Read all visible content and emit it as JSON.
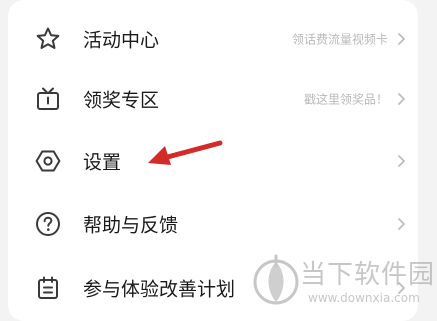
{
  "menu": {
    "items": [
      {
        "label": "活动中心",
        "hint": "领话费流量视频卡",
        "icon": "star-icon"
      },
      {
        "label": "领奖专区",
        "hint": "戳这里领奖品！",
        "icon": "gift-box-icon"
      },
      {
        "label": "设置",
        "hint": "",
        "icon": "gear-hexagon-icon"
      },
      {
        "label": "帮助与反馈",
        "hint": "",
        "icon": "help-circle-icon"
      },
      {
        "label": "参与体验改善计划",
        "hint": "",
        "icon": "clipboard-icon"
      }
    ]
  },
  "annotation": {
    "icon": "red-arrow-icon",
    "color": "#d32a2a"
  },
  "watermark": {
    "name": "当下软件园",
    "url": "www.downxia.com",
    "icon": "downxia-logo-icon"
  },
  "colors": {
    "background": "#f3f3f3",
    "card": "#ffffff",
    "label": "#1a1a1a",
    "hint": "#b9b9b9",
    "icon": "#3a3a3a"
  }
}
